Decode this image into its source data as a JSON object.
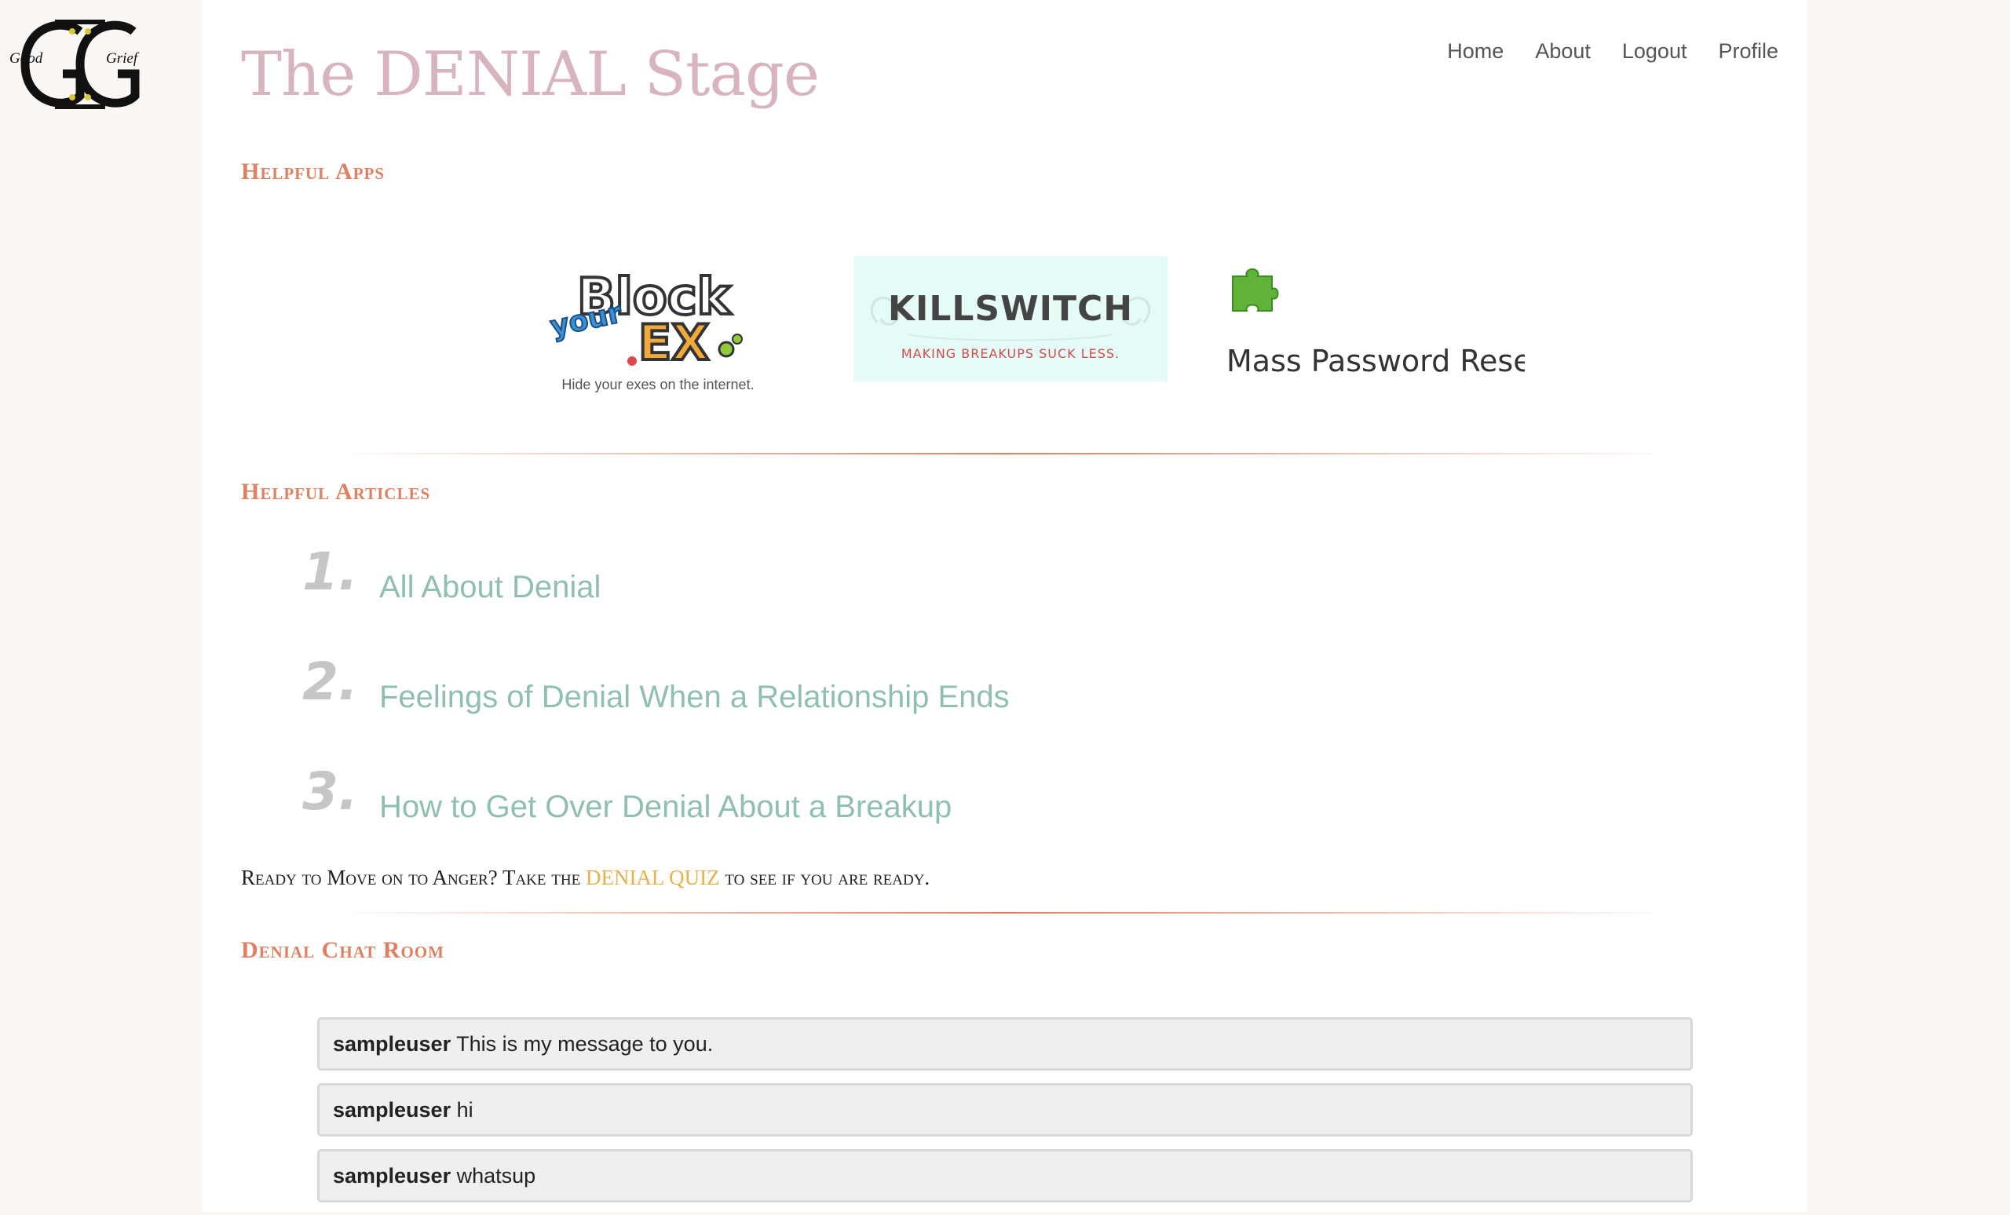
{
  "logo": {
    "left_word": "Good",
    "right_word": "Grief"
  },
  "page": {
    "title": "The DENIAL Stage"
  },
  "nav": {
    "home": "Home",
    "about": "About",
    "logout": "Logout",
    "profile": "Profile"
  },
  "sections": {
    "apps": "Helpful Apps",
    "articles": "Helpful Articles",
    "chat": "Denial Chat Room"
  },
  "apps": {
    "block_your_ex": {
      "logo_text": [
        "Block",
        "your",
        "EX"
      ],
      "tagline": "Hide your exes on the internet."
    },
    "killswitch": {
      "title": "KILLSWITCH",
      "subtitle": "MAKING BREAKUPS SUCK LESS."
    },
    "mass_password_reset": {
      "title": "Mass Password Reset"
    }
  },
  "articles": [
    {
      "number": "1.",
      "title": "All About Denial"
    },
    {
      "number": "2.",
      "title": "Feelings of Denial When a Relationship Ends"
    },
    {
      "number": "3.",
      "title": "How to Get Over Denial About a Breakup"
    }
  ],
  "quiz": {
    "prefix": "Ready to Move on to Anger? Take the",
    "link": "DENIAL QUIZ",
    "suffix": "to see if you are ready."
  },
  "chat": {
    "messages": [
      {
        "user": "sampleuser",
        "text": "This is my message to you."
      },
      {
        "user": "sampleuser",
        "text": "hi"
      },
      {
        "user": "sampleuser",
        "text": "whatsup"
      }
    ]
  },
  "colors": {
    "title": "#d8b4bd",
    "section_heading": "#e08060",
    "article_link": "#8ebfb0",
    "quiz_link": "#e8b04a",
    "page_bg": "#faf7f4"
  }
}
